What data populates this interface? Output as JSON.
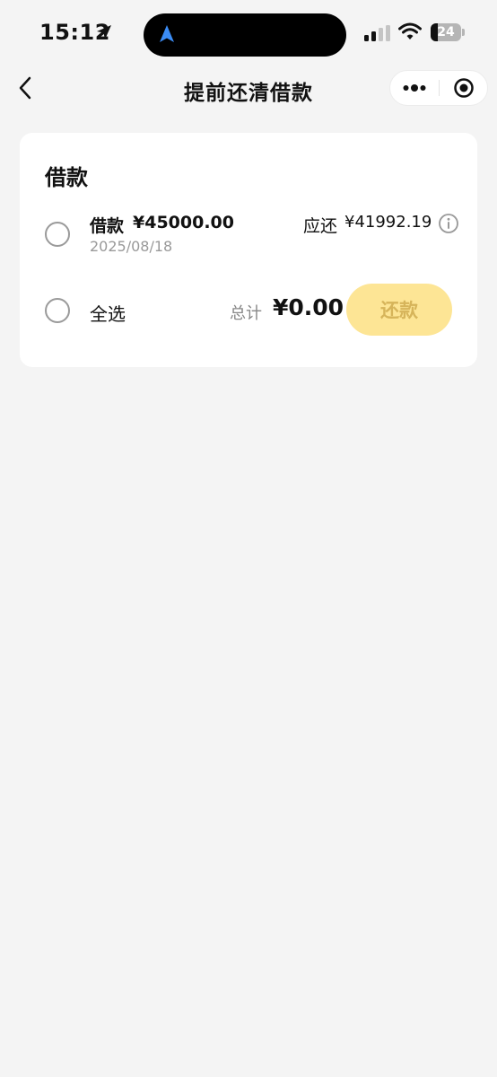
{
  "status_bar": {
    "time": "15:12",
    "battery_level": "24",
    "battery_fraction": 0.24,
    "icons": [
      "navigation-arrow-icon",
      "island-navigation-icon",
      "cellular-signal-icon",
      "wifi-icon",
      "battery-icon"
    ]
  },
  "nav": {
    "title": "提前还清借款",
    "icons": [
      "back-chevron-icon",
      "more-dots-icon",
      "close-target-icon"
    ]
  },
  "card": {
    "title": "借款",
    "loan": {
      "name": "借款",
      "amount": "¥45000.00",
      "date": "2025/08/18",
      "due_label": "应还",
      "due_amount": "¥41992.19",
      "info_icon": "info-icon",
      "selected": false
    },
    "footer": {
      "select_all_label": "全选",
      "select_all_checked": false,
      "total_label": "总计",
      "total_amount": "¥0.00",
      "repay_button_label": "还款",
      "repay_button_enabled": false
    }
  },
  "colors": {
    "background": "#f4f4f4",
    "card": "#ffffff",
    "button_disabled_bg": "#fde595",
    "button_disabled_text": "#d6b45a",
    "island_nav_icon": "#3b8cf5"
  }
}
